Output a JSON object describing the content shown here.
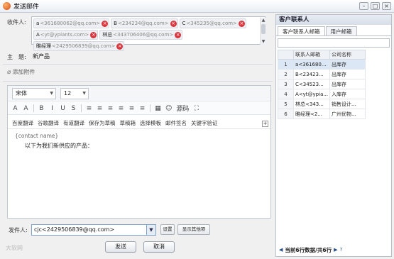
{
  "window": {
    "title": "发送邮件"
  },
  "labels": {
    "to": "收件人:",
    "subject": "主　题:",
    "sender": "发件人:"
  },
  "recipients": [
    {
      "name": "a",
      "addr": "<361680062@qq.com>"
    },
    {
      "name": "B",
      "addr": "<234234@qq.com>"
    },
    {
      "name": "C",
      "addr": "<345235@qq.com>"
    },
    {
      "name": "A",
      "addr": "<yt@ypiants.com>"
    },
    {
      "name": "林总",
      "addr": "<343706406@qq.com>"
    },
    {
      "name": "睢经理",
      "addr": "<2429506839@qq.com>"
    }
  ],
  "subject": {
    "value": "新产品"
  },
  "attach": {
    "label": "添加附件"
  },
  "editor": {
    "font_family": "宋体",
    "font_size": "12",
    "format_buttons": [
      "A",
      "A",
      "B",
      "I",
      "U",
      "S",
      "≡",
      "≡",
      "≡",
      "≡",
      "≡",
      "≡",
      "▦",
      "☺",
      "源码",
      "⛶"
    ],
    "quick_buttons": [
      "百度翻译",
      "谷歌翻译",
      "有道翻译",
      "保存为草稿",
      "草稿箱",
      "选择模板",
      "邮件签名",
      "关键字验证"
    ],
    "body_line1": "{contact name}",
    "body_line2": "以下为我们新供应的产品："
  },
  "sender": {
    "value": "cjc<2429506839@qq.com>",
    "settings_label": "设置",
    "show_others_label": "显示其他项"
  },
  "actions": {
    "send_label": "发送",
    "cancel_label": "取消",
    "watermark": "大软网"
  },
  "contacts": {
    "title": "客户联系人",
    "tabs": [
      "客户联系人邮箱",
      "用户邮箱"
    ],
    "columns": [
      "联系人邮箱",
      "公司名称"
    ],
    "rows": [
      {
        "idx": "1",
        "email": "a<361680...",
        "company": "出库存"
      },
      {
        "idx": "2",
        "email": "B<23423...",
        "company": "出库存"
      },
      {
        "idx": "3",
        "email": "C<34523...",
        "company": "出库存"
      },
      {
        "idx": "4",
        "email": "A<yt@ypia...",
        "company": "入库存"
      },
      {
        "idx": "5",
        "email": "林总<343...",
        "company": "销售设计..."
      },
      {
        "idx": "6",
        "email": "睢经理<2...",
        "company": "广州优物..."
      }
    ],
    "pager_text": "当前6行数据/共6行"
  }
}
